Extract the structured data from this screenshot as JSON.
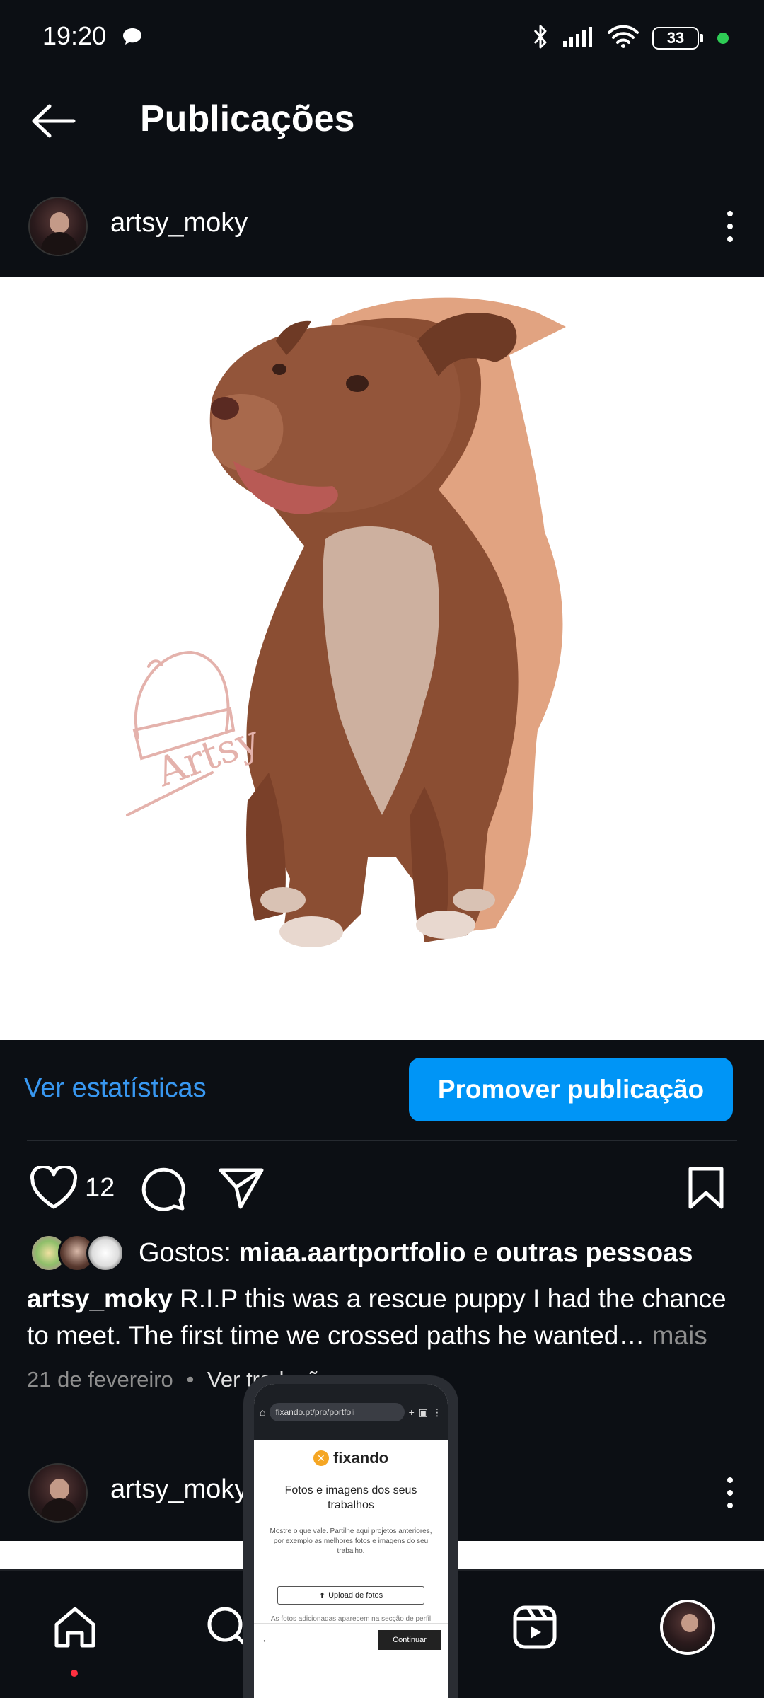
{
  "status_bar": {
    "time": "19:20",
    "battery": "33",
    "icons": [
      "chat-bubble-icon",
      "bluetooth-icon",
      "signal-icon",
      "wifi-icon",
      "battery-icon"
    ]
  },
  "header": {
    "title": "Publicações",
    "back_icon": "arrow-left-icon"
  },
  "post": {
    "username": "artsy_moky",
    "image_signature": "Artsy",
    "stats_link": "Ver estatísticas",
    "promote_button": "Promover publicação",
    "like_count": "12",
    "likes_prefix": "Gostos:",
    "likes_user": "miaa.aartportfolio",
    "likes_connector": "e",
    "likes_others": "outras pessoas",
    "caption_user": "artsy_moky",
    "caption_text": "R.I.P this was a rescue puppy I had the chance to meet. The first time we crossed paths he wanted…",
    "caption_more": "mais",
    "date": "21 de fevereiro",
    "separator": "•",
    "translate": "Ver tradução"
  },
  "next_post": {
    "username": "artsy_moky"
  },
  "pip_window": {
    "url": "fixando.pt/pro/portfoli",
    "brand": "fixando",
    "heading": "Fotos e imagens dos seus trabalhos",
    "body": "Mostre o que vale. Partilhe aqui projetos anteriores, por exemplo as melhores fotos e imagens do seu trabalho.",
    "upload_button": "Upload de fotos",
    "note": "As fotos adicionadas aparecem na secção de perfil",
    "back": "←",
    "continue_button": "Continuar"
  },
  "bottom_nav": {
    "items": [
      "home-icon",
      "search-icon",
      "reels-icon",
      "profile-avatar"
    ]
  },
  "colors": {
    "background": "#0c0f14",
    "accent_blue": "#0095f6",
    "link_blue": "#3897f0",
    "notification_red": "#ff3040",
    "battery_dot_green": "#2ecc55"
  }
}
